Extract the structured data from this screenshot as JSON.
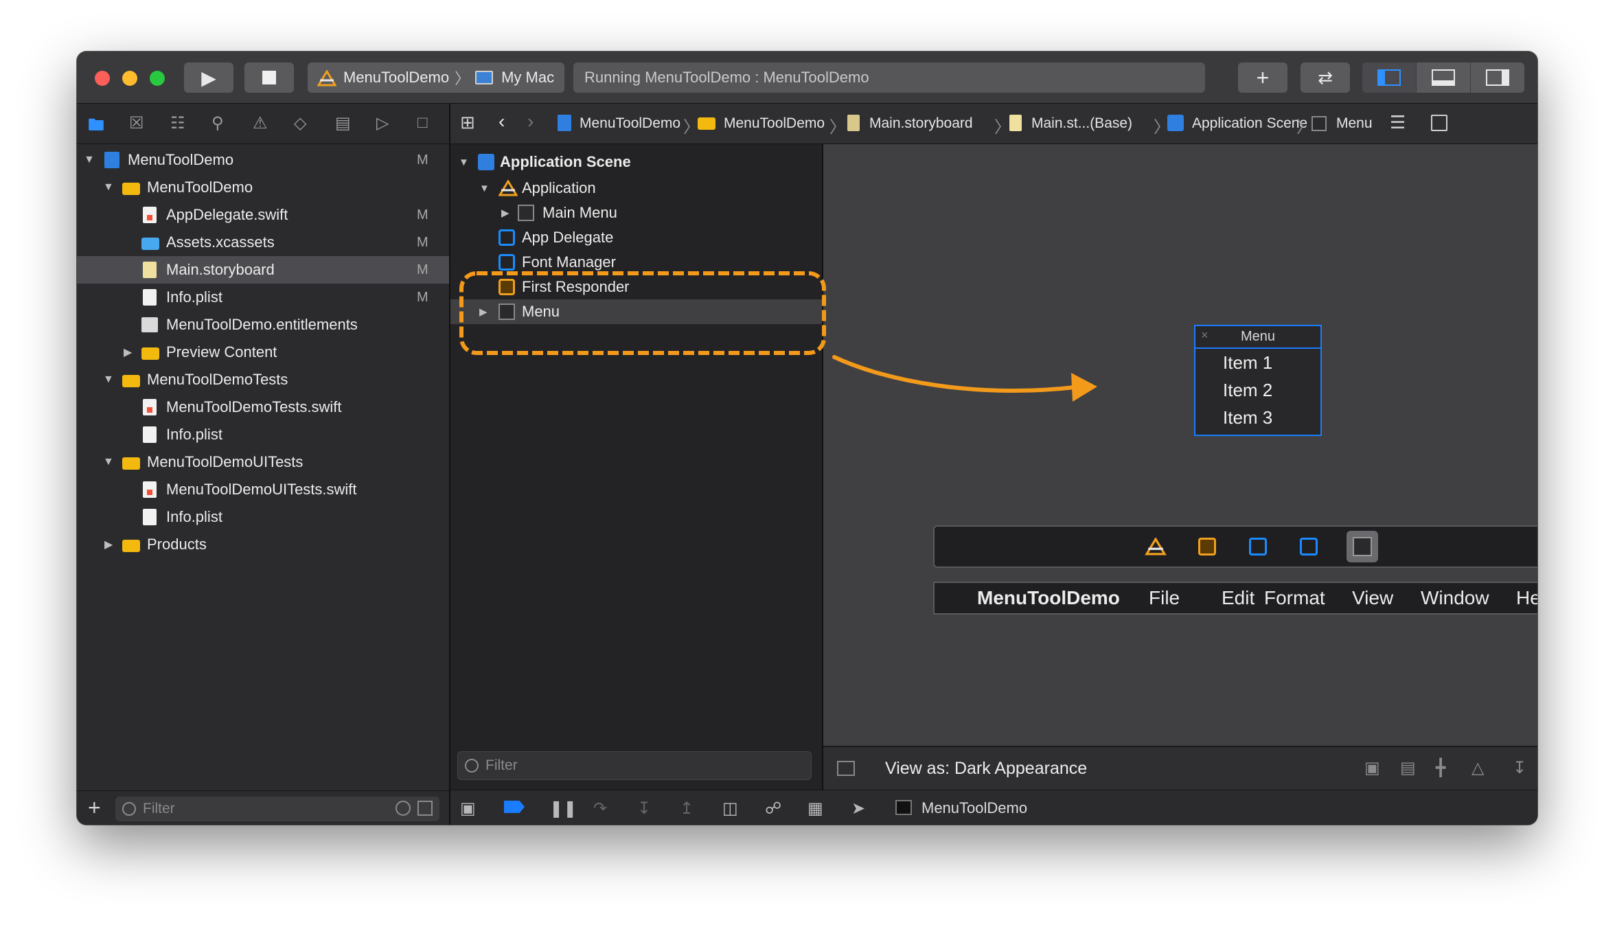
{
  "toolbar": {
    "scheme": "MenuToolDemo",
    "destination": "My Mac",
    "status": "Running MenuToolDemo : MenuToolDemo"
  },
  "navigator": {
    "items": [
      {
        "label": "MenuToolDemo",
        "badge": "M"
      },
      {
        "label": "MenuToolDemo",
        "badge": ""
      },
      {
        "label": "AppDelegate.swift",
        "badge": "M"
      },
      {
        "label": "Assets.xcassets",
        "badge": "M"
      },
      {
        "label": "Main.storyboard",
        "badge": "M"
      },
      {
        "label": "Info.plist",
        "badge": "M"
      },
      {
        "label": "MenuToolDemo.entitlements",
        "badge": ""
      },
      {
        "label": "Preview Content",
        "badge": ""
      },
      {
        "label": "MenuToolDemoTests",
        "badge": ""
      },
      {
        "label": "MenuToolDemoTests.swift",
        "badge": ""
      },
      {
        "label": "Info.plist",
        "badge": ""
      },
      {
        "label": "MenuToolDemoUITests",
        "badge": ""
      },
      {
        "label": "MenuToolDemoUITests.swift",
        "badge": ""
      },
      {
        "label": "Info.plist",
        "badge": ""
      },
      {
        "label": "Products",
        "badge": ""
      }
    ],
    "filter_placeholder": "Filter"
  },
  "jumpbar": {
    "crumbs": [
      "MenuToolDemo",
      "MenuToolDemo",
      "Main.storyboard",
      "Main.st...(Base)",
      "Application Scene",
      "Menu"
    ]
  },
  "outline": {
    "items": [
      "Application Scene",
      "Application",
      "Main Menu",
      "App Delegate",
      "Font Manager",
      "First Responder",
      "Menu"
    ],
    "filter_placeholder": "Filter"
  },
  "canvas": {
    "menu_title": "Menu",
    "menu_items": [
      "Item 1",
      "Item 2",
      "Item 3"
    ],
    "menubar_items": [
      "MenuToolDemo",
      "File",
      "Edit",
      "Format",
      "View",
      "Window",
      "Help"
    ],
    "view_as": "View as: Dark Appearance"
  },
  "debug": {
    "target": "MenuToolDemo"
  },
  "colors": {
    "accent": "#1a7cff",
    "annotation": "#f39a1b"
  }
}
